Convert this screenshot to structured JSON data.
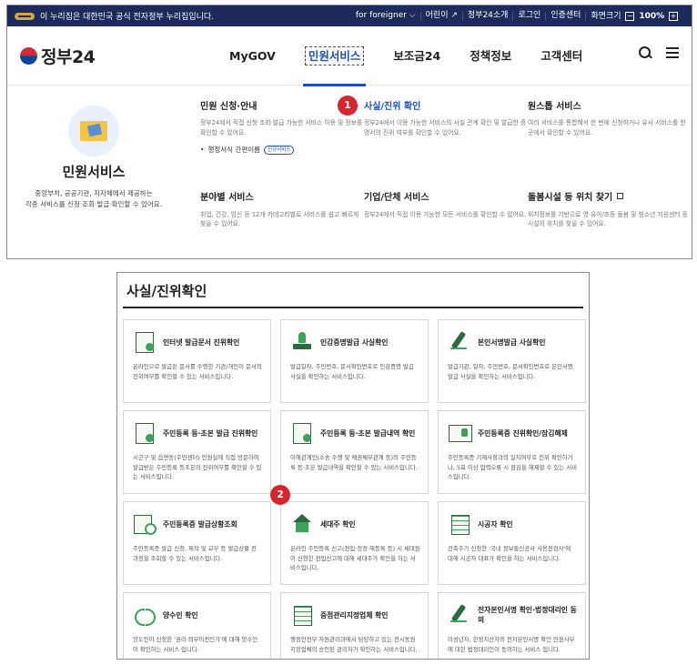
{
  "gov_bar": {
    "notice": "이 누리집은 대한민국 공식 전자정부 누리집입니다.",
    "links": [
      "for foreigner ⌵",
      "어린이 ↗",
      "정부24소개",
      "로그인",
      "인증센터"
    ],
    "font_size_label": "화면크기",
    "zoom_minus": "−",
    "zoom_value": "100%",
    "zoom_plus": "+"
  },
  "header": {
    "logo_text": "정부24",
    "nav": [
      "MyGOV",
      "민원서비스",
      "보조금24",
      "정책정보",
      "고객센터"
    ],
    "active_nav": "민원서비스"
  },
  "mega": {
    "left_title": "민원서비스",
    "left_desc_1": "중앙부처, 공공기관, 지자체에서 제공하는",
    "left_desc_2": "각종 서비스를 신청·조회·발급·확인할 수 있어요.",
    "col1_title": "민원 신청·안내",
    "col1_desc": "정부24에서 직접 신청·조회·발급 가능한 서비스 이용 및 정보를 확인할 수 있어요.",
    "col1_sub": "행정서식 간편이름",
    "col1_badge": "신규서비스",
    "col2_title": "사실/진위 확인",
    "col2_desc": "정부24에서 이용 가능한 서비스의 사실 관계 확인 및 발급한 증명서의 진위 여부를 확인할 수 있어요.",
    "col3_title": "원스톱 서비스",
    "col3_desc": "여러 서비스를 통합해서 한 번에 신청하거나 유사 서비스를 한 곳에서 확인할 수 있어요.",
    "col4_title": "분야별 서비스",
    "col4_desc": "취업, 건강, 임신 등 12개 카테고리별로 서비스를 쉽고 빠르게 찾을 수 있어요.",
    "col5_title": "기업/단체 서비스",
    "col5_desc": "정부24에서 직접 이용 가능한 모든 서비스를 확인할 수 있어요.",
    "col6_title": "돌봄시설 등 위치 찾기",
    "col6_desc": "위치정보를 기반으로 영·유아/초등 돌봄 및 청소년 지원센터 등 시설의 위치를 찾을 수 있어요."
  },
  "markers": [
    "1",
    "2"
  ],
  "section": {
    "title": "사실/진위확인",
    "cards": [
      {
        "icon": "document-check-icon",
        "name": "인터넷 발급문서 진위확인",
        "desc": "온라인으로 발급된 문서를 수령한 기관/개인이 문서의 진위여부를 확인할 수 있는 서비스입니다."
      },
      {
        "icon": "seal-stamp-icon",
        "name": "인감증명발급 사실확인",
        "desc": "발급일자, 주민번호, 문서확인번호로 인감증명 발급 사실을 확인하는 서비스입니다."
      },
      {
        "icon": "pen-sign-icon",
        "name": "본인서명발급 사실확인",
        "desc": "발급기관, 일자, 주민번호, 문서확인번호로 본인서명 발급 사실을 확인하는 서비스입니다."
      },
      {
        "icon": "resident-doc-icon",
        "name": "주민등록 등·초본 발급 진위확인",
        "desc": "시군구 및 읍면동(주민센터) 민원실에 직접 방문하여 발급받은 주민등록 등초본의 진위여부를 확인할 수 있는 서비스입니다."
      },
      {
        "icon": "resident-history-icon",
        "name": "주민등록 등·초본 발급내역 확인",
        "desc": "이해관계인(소송 수행 및 채권채무관계 등)의 주민등록 등·초본 발급내역을 확인할 수 있는 서비스입니다."
      },
      {
        "icon": "id-card-icon",
        "name": "주민등록증 진위확인/잠김해제",
        "desc": "주민등록증 기재사항과의 일치여부로 진위 확인하거나, 5회 이상 입력오류 시 잠김을 해제할 수 있는 서비스입니다."
      },
      {
        "icon": "id-search-icon",
        "name": "주민등록증 발급상황조회",
        "desc": "주민등록증 발급 신청, 제작 및 교부 등 발급상황 전 과정을 조회할 수 있는 서비스입니다."
      },
      {
        "icon": "household-icon",
        "name": "세대주 확인",
        "desc": "온라인 주민등록 신고(전입·정정·재등록 등) 시 세대원이 신청한 전입신고에 대해 세대주가 확인을 하는 서비스입니다."
      },
      {
        "icon": "building-user-icon",
        "name": "시공자 확인",
        "desc": "건축주가 신청한 '국내 정보통신공사 사용전검사'에 대해 시공자 대표가 확인을 하는 서비스입니다."
      },
      {
        "icon": "handshake-icon",
        "name": "양수인 확인",
        "desc": "양도인이 신청한 '권리·의무이전인가'에 대해 양수인이 확인하는 서비스 입니다."
      },
      {
        "icon": "building-icon",
        "name": "중점관리지정업체 확인",
        "desc": "행정안전부 자원관리과에서 담당하고 있는 전시동원 지정업체의 승인된 관리자가 확인하는 서비스입니다."
      },
      {
        "icon": "pen-sign-icon",
        "name": "전자본인서명 확인·법정대리인 동의",
        "desc": "미성년자, 한정치산자의 전자본인서명 확인 민원사무에 대한 법정대리인이 동의하는 서비스 입니다."
      }
    ]
  }
}
